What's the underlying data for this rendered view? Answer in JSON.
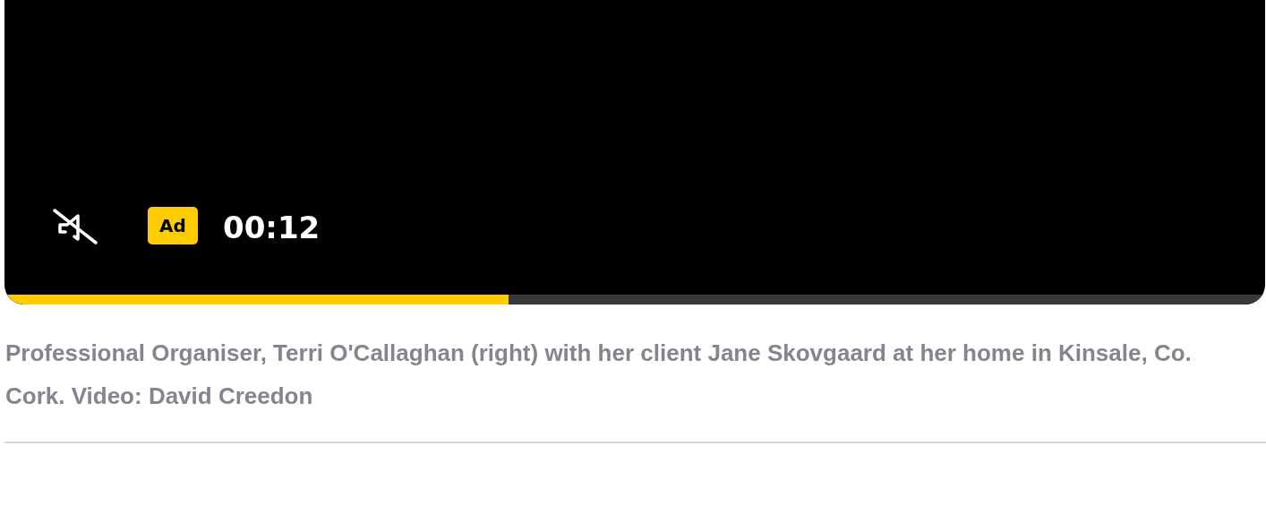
{
  "player": {
    "muted": true,
    "badge": "Ad",
    "time": "00:12",
    "progress": {
      "level": 0.4
    }
  },
  "caption": "Professional Organiser, Terri O'Callaghan (right) with her client Jane Skovgaard at her home in Kinsale, Co. Cork. Video: David Creedon"
}
